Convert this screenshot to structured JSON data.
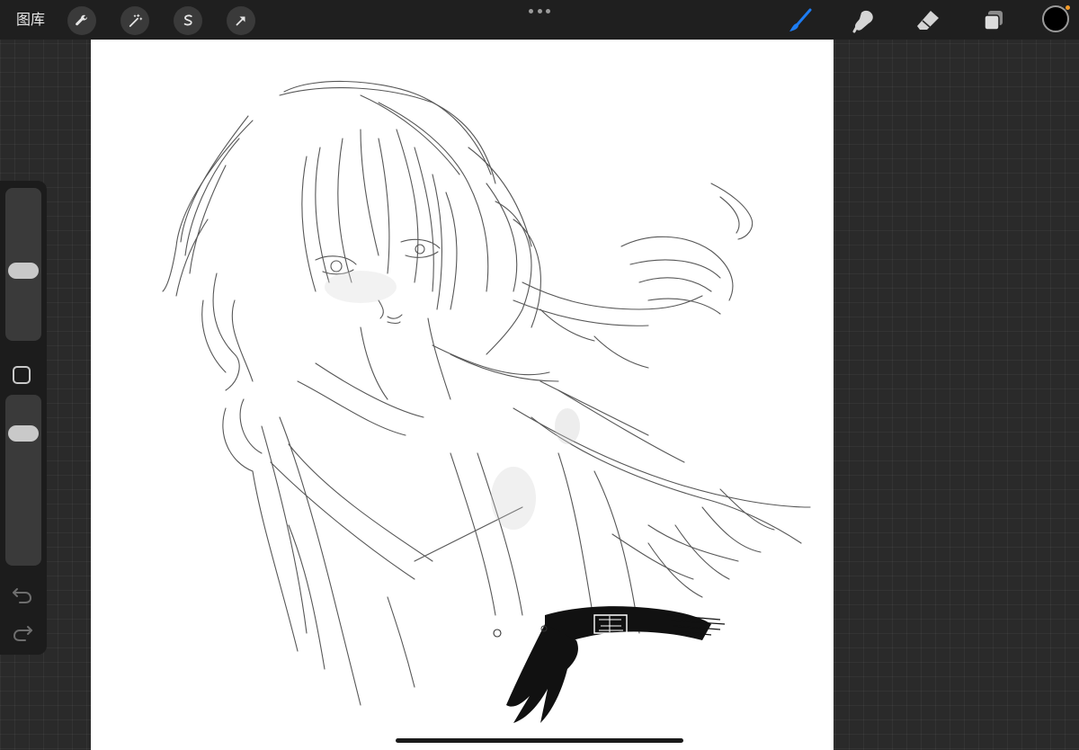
{
  "topbar": {
    "gallery_label": "图库",
    "left_tools": [
      {
        "icon": "wrench-icon"
      },
      {
        "icon": "magic-wand-icon"
      },
      {
        "icon": "selection-s-icon"
      },
      {
        "icon": "arrow-cursor-icon"
      }
    ],
    "right_tools": [
      {
        "icon": "brush-icon",
        "active": true
      },
      {
        "icon": "smudge-icon"
      },
      {
        "icon": "eraser-icon"
      },
      {
        "icon": "layers-icon"
      }
    ],
    "current_color": "#000000",
    "accent_color": "#1d7cf2"
  },
  "sidebar": {
    "brush_size": 0.45,
    "opacity": 0.82
  },
  "colors": {
    "canvas": "#ffffff",
    "background": "#2a2a2a",
    "toolbar": "#1f1f1f"
  }
}
